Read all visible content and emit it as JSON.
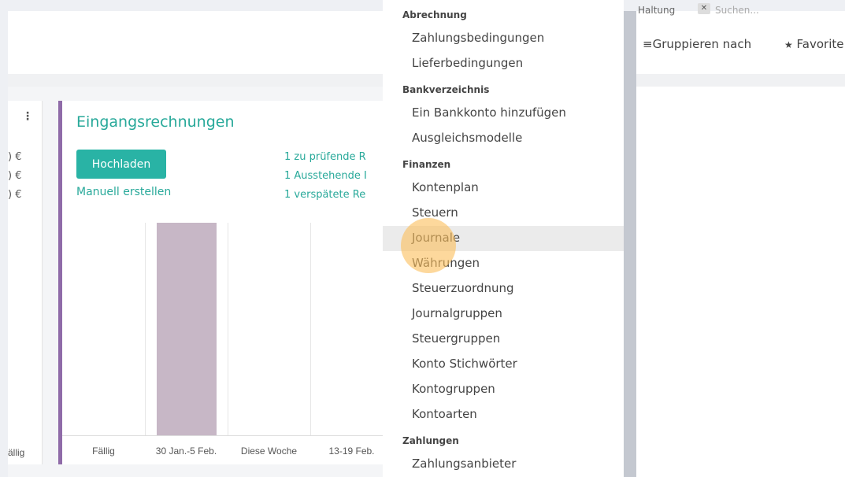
{
  "search": {
    "facet": "Haltung",
    "placeholder": "Suchen..."
  },
  "toolbar": {
    "group_by": "Gruppieren nach",
    "favorites": "Favorite"
  },
  "left_card": {
    "amounts": [
      ") €",
      ") €",
      ") €"
    ],
    "footer": "ällig"
  },
  "invoice_card": {
    "title": "Eingangsrechnungen",
    "upload_button": "Hochladen",
    "manual_link": "Manuell erstellen",
    "links": [
      "1 zu prüfende R",
      "1 Ausstehende I",
      "1 verspätete Re"
    ]
  },
  "chart_data": {
    "type": "bar",
    "categories": [
      "Fällig",
      "30 Jan.-5 Feb.",
      "Diese Woche",
      "13-19 Feb."
    ],
    "values": [
      0,
      1,
      0,
      0
    ],
    "ylim": [
      0,
      1
    ],
    "bar_color": "#c7b7c6"
  },
  "menu": {
    "sections": [
      {
        "title": "Abrechnung",
        "items": [
          "Zahlungsbedingungen",
          "Lieferbedingungen"
        ]
      },
      {
        "title": "Bankverzeichnis",
        "items": [
          "Ein Bankkonto hinzufügen",
          "Ausgleichsmodelle"
        ]
      },
      {
        "title": "Finanzen",
        "items": [
          "Kontenplan",
          "Steuern",
          "Journale",
          "Währungen",
          "Steuerzuordnung",
          "Journalgruppen",
          "Steuergruppen",
          "Konto Stichwörter",
          "Kontogruppen",
          "Kontoarten"
        ]
      },
      {
        "title": "Zahlungen",
        "items": [
          "Zahlungsanbieter"
        ]
      }
    ],
    "hovered_item": "Journale"
  },
  "colors": {
    "accent": "#28a99a",
    "button": "#29b3a5",
    "card_border": "#8f6ba8",
    "cursor": "#fbbe5a"
  }
}
